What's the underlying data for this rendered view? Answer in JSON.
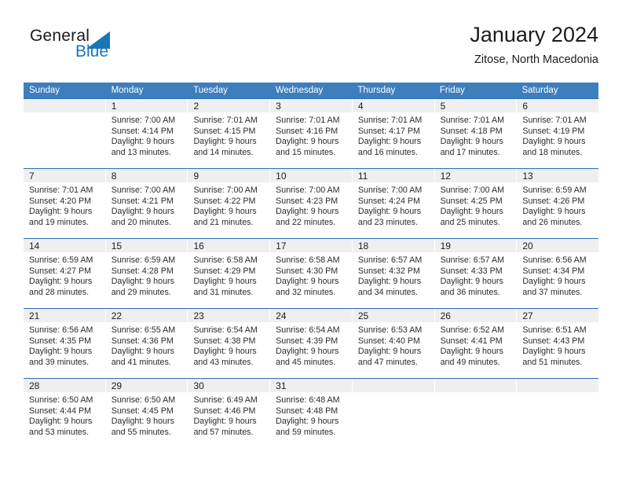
{
  "brand": {
    "logo_text_primary": "General",
    "logo_text_secondary": "Blue",
    "logo_icon": "triangle-flag-icon",
    "accent_color": "#1b75bb"
  },
  "header": {
    "title": "January 2024",
    "subtitle": "Zitose, North Macedonia",
    "header_bg_color": "#3d7ebd",
    "row_divider_color": "#2e6cad",
    "daynum_band_color": "#efefef"
  },
  "weekdays": [
    "Sunday",
    "Monday",
    "Tuesday",
    "Wednesday",
    "Thursday",
    "Friday",
    "Saturday"
  ],
  "weeks": [
    [
      {
        "day": "",
        "l1": "",
        "l2": "",
        "l3": "",
        "l4": ""
      },
      {
        "day": "1",
        "l1": "Sunrise: 7:00 AM",
        "l2": "Sunset: 4:14 PM",
        "l3": "Daylight: 9 hours",
        "l4": "and 13 minutes."
      },
      {
        "day": "2",
        "l1": "Sunrise: 7:01 AM",
        "l2": "Sunset: 4:15 PM",
        "l3": "Daylight: 9 hours",
        "l4": "and 14 minutes."
      },
      {
        "day": "3",
        "l1": "Sunrise: 7:01 AM",
        "l2": "Sunset: 4:16 PM",
        "l3": "Daylight: 9 hours",
        "l4": "and 15 minutes."
      },
      {
        "day": "4",
        "l1": "Sunrise: 7:01 AM",
        "l2": "Sunset: 4:17 PM",
        "l3": "Daylight: 9 hours",
        "l4": "and 16 minutes."
      },
      {
        "day": "5",
        "l1": "Sunrise: 7:01 AM",
        "l2": "Sunset: 4:18 PM",
        "l3": "Daylight: 9 hours",
        "l4": "and 17 minutes."
      },
      {
        "day": "6",
        "l1": "Sunrise: 7:01 AM",
        "l2": "Sunset: 4:19 PM",
        "l3": "Daylight: 9 hours",
        "l4": "and 18 minutes."
      }
    ],
    [
      {
        "day": "7",
        "l1": "Sunrise: 7:01 AM",
        "l2": "Sunset: 4:20 PM",
        "l3": "Daylight: 9 hours",
        "l4": "and 19 minutes."
      },
      {
        "day": "8",
        "l1": "Sunrise: 7:00 AM",
        "l2": "Sunset: 4:21 PM",
        "l3": "Daylight: 9 hours",
        "l4": "and 20 minutes."
      },
      {
        "day": "9",
        "l1": "Sunrise: 7:00 AM",
        "l2": "Sunset: 4:22 PM",
        "l3": "Daylight: 9 hours",
        "l4": "and 21 minutes."
      },
      {
        "day": "10",
        "l1": "Sunrise: 7:00 AM",
        "l2": "Sunset: 4:23 PM",
        "l3": "Daylight: 9 hours",
        "l4": "and 22 minutes."
      },
      {
        "day": "11",
        "l1": "Sunrise: 7:00 AM",
        "l2": "Sunset: 4:24 PM",
        "l3": "Daylight: 9 hours",
        "l4": "and 23 minutes."
      },
      {
        "day": "12",
        "l1": "Sunrise: 7:00 AM",
        "l2": "Sunset: 4:25 PM",
        "l3": "Daylight: 9 hours",
        "l4": "and 25 minutes."
      },
      {
        "day": "13",
        "l1": "Sunrise: 6:59 AM",
        "l2": "Sunset: 4:26 PM",
        "l3": "Daylight: 9 hours",
        "l4": "and 26 minutes."
      }
    ],
    [
      {
        "day": "14",
        "l1": "Sunrise: 6:59 AM",
        "l2": "Sunset: 4:27 PM",
        "l3": "Daylight: 9 hours",
        "l4": "and 28 minutes."
      },
      {
        "day": "15",
        "l1": "Sunrise: 6:59 AM",
        "l2": "Sunset: 4:28 PM",
        "l3": "Daylight: 9 hours",
        "l4": "and 29 minutes."
      },
      {
        "day": "16",
        "l1": "Sunrise: 6:58 AM",
        "l2": "Sunset: 4:29 PM",
        "l3": "Daylight: 9 hours",
        "l4": "and 31 minutes."
      },
      {
        "day": "17",
        "l1": "Sunrise: 6:58 AM",
        "l2": "Sunset: 4:30 PM",
        "l3": "Daylight: 9 hours",
        "l4": "and 32 minutes."
      },
      {
        "day": "18",
        "l1": "Sunrise: 6:57 AM",
        "l2": "Sunset: 4:32 PM",
        "l3": "Daylight: 9 hours",
        "l4": "and 34 minutes."
      },
      {
        "day": "19",
        "l1": "Sunrise: 6:57 AM",
        "l2": "Sunset: 4:33 PM",
        "l3": "Daylight: 9 hours",
        "l4": "and 36 minutes."
      },
      {
        "day": "20",
        "l1": "Sunrise: 6:56 AM",
        "l2": "Sunset: 4:34 PM",
        "l3": "Daylight: 9 hours",
        "l4": "and 37 minutes."
      }
    ],
    [
      {
        "day": "21",
        "l1": "Sunrise: 6:56 AM",
        "l2": "Sunset: 4:35 PM",
        "l3": "Daylight: 9 hours",
        "l4": "and 39 minutes."
      },
      {
        "day": "22",
        "l1": "Sunrise: 6:55 AM",
        "l2": "Sunset: 4:36 PM",
        "l3": "Daylight: 9 hours",
        "l4": "and 41 minutes."
      },
      {
        "day": "23",
        "l1": "Sunrise: 6:54 AM",
        "l2": "Sunset: 4:38 PM",
        "l3": "Daylight: 9 hours",
        "l4": "and 43 minutes."
      },
      {
        "day": "24",
        "l1": "Sunrise: 6:54 AM",
        "l2": "Sunset: 4:39 PM",
        "l3": "Daylight: 9 hours",
        "l4": "and 45 minutes."
      },
      {
        "day": "25",
        "l1": "Sunrise: 6:53 AM",
        "l2": "Sunset: 4:40 PM",
        "l3": "Daylight: 9 hours",
        "l4": "and 47 minutes."
      },
      {
        "day": "26",
        "l1": "Sunrise: 6:52 AM",
        "l2": "Sunset: 4:41 PM",
        "l3": "Daylight: 9 hours",
        "l4": "and 49 minutes."
      },
      {
        "day": "27",
        "l1": "Sunrise: 6:51 AM",
        "l2": "Sunset: 4:43 PM",
        "l3": "Daylight: 9 hours",
        "l4": "and 51 minutes."
      }
    ],
    [
      {
        "day": "28",
        "l1": "Sunrise: 6:50 AM",
        "l2": "Sunset: 4:44 PM",
        "l3": "Daylight: 9 hours",
        "l4": "and 53 minutes."
      },
      {
        "day": "29",
        "l1": "Sunrise: 6:50 AM",
        "l2": "Sunset: 4:45 PM",
        "l3": "Daylight: 9 hours",
        "l4": "and 55 minutes."
      },
      {
        "day": "30",
        "l1": "Sunrise: 6:49 AM",
        "l2": "Sunset: 4:46 PM",
        "l3": "Daylight: 9 hours",
        "l4": "and 57 minutes."
      },
      {
        "day": "31",
        "l1": "Sunrise: 6:48 AM",
        "l2": "Sunset: 4:48 PM",
        "l3": "Daylight: 9 hours",
        "l4": "and 59 minutes."
      },
      {
        "day": "",
        "l1": "",
        "l2": "",
        "l3": "",
        "l4": ""
      },
      {
        "day": "",
        "l1": "",
        "l2": "",
        "l3": "",
        "l4": ""
      },
      {
        "day": "",
        "l1": "",
        "l2": "",
        "l3": "",
        "l4": ""
      }
    ]
  ]
}
